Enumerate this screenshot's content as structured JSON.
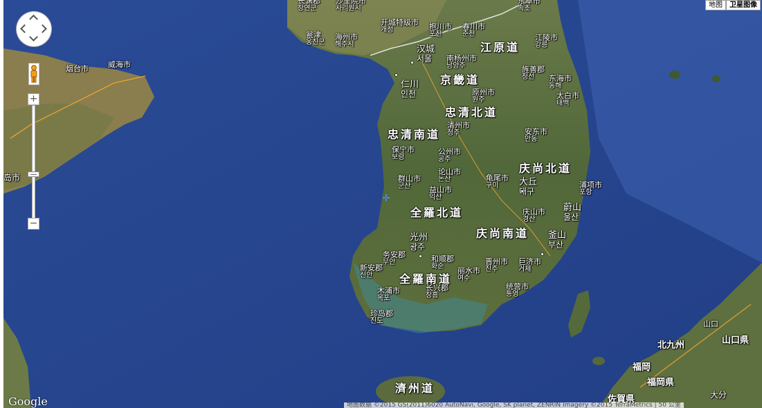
{
  "map_type": {
    "map_label": "地图",
    "satellite_label": "卫星图像",
    "active": "satellite"
  },
  "controls": {
    "zoom_in": "+",
    "zoom_out": "−"
  },
  "provinces": [
    {
      "name": "江原道"
    },
    {
      "name": "京畿道"
    },
    {
      "name": "忠清北道"
    },
    {
      "name": "忠清南道"
    },
    {
      "name": "庆尚北道"
    },
    {
      "name": "全羅北道"
    },
    {
      "name": "庆尚南道"
    },
    {
      "name": "全羅南道"
    },
    {
      "name": "濟州道"
    }
  ],
  "cities": [
    {
      "name": "长渊郡",
      "sub": "장연군"
    },
    {
      "name": "沙里院市",
      "sub": "사리원시"
    },
    {
      "name": "东草市",
      "sub": "속초"
    },
    {
      "name": "瓮津",
      "sub": "옹진군"
    },
    {
      "name": "海州市",
      "sub": "해주시"
    },
    {
      "name": "开城特级市",
      "sub": "개성"
    },
    {
      "name": "抱川市",
      "sub": "포천"
    },
    {
      "name": "春川市",
      "sub": "춘천"
    },
    {
      "name": "江陵市",
      "sub": "강릉"
    },
    {
      "name": "汉城",
      "sub": "서울"
    },
    {
      "name": "南杨州市",
      "sub": "남양주"
    },
    {
      "name": "旌善郡",
      "sub": "정선"
    },
    {
      "name": "东海市",
      "sub": "동해"
    },
    {
      "name": "仁川",
      "sub": "인천"
    },
    {
      "name": "原州市",
      "sub": "원주"
    },
    {
      "name": "太白市",
      "sub": "태백"
    },
    {
      "name": "清州市",
      "sub": "청주"
    },
    {
      "name": "安东市",
      "sub": "안동"
    },
    {
      "name": "保宁市",
      "sub": "보령"
    },
    {
      "name": "公州市",
      "sub": "공주"
    },
    {
      "name": "论山市",
      "sub": "논산"
    },
    {
      "name": "群山市",
      "sub": "군산"
    },
    {
      "name": "益山市",
      "sub": "익산"
    },
    {
      "name": "龟尾市",
      "sub": "구미"
    },
    {
      "name": "大丘",
      "sub": "대구"
    },
    {
      "name": "浦项市",
      "sub": "포항"
    },
    {
      "name": "庆山市",
      "sub": "경산"
    },
    {
      "name": "蔚山",
      "sub": "울산"
    },
    {
      "name": "光州",
      "sub": "광주"
    },
    {
      "name": "釜山",
      "sub": "부산"
    },
    {
      "name": "务安郡",
      "sub": "무안"
    },
    {
      "name": "和顺郡",
      "sub": "화순"
    },
    {
      "name": "晋州市",
      "sub": "진주"
    },
    {
      "name": "巨济市",
      "sub": "거제"
    },
    {
      "name": "新安郡",
      "sub": "신안"
    },
    {
      "name": "丽水市",
      "sub": "여수"
    },
    {
      "name": "木浦市",
      "sub": "목포"
    },
    {
      "name": "长兴郡",
      "sub": "장흥"
    },
    {
      "name": "统营市",
      "sub": "통영"
    },
    {
      "name": "珍岛郡",
      "sub": "진도"
    },
    {
      "name": "烟台市",
      "sub": ""
    },
    {
      "name": "威海市",
      "sub": ""
    },
    {
      "name": "青岛市",
      "sub": ""
    },
    {
      "name": "山口",
      "sub": ""
    },
    {
      "name": "北九州",
      "sub": ""
    },
    {
      "name": "山口県",
      "sub": ""
    },
    {
      "name": "福岡",
      "sub": ""
    },
    {
      "name": "福岡県",
      "sub": ""
    },
    {
      "name": "佐賀県",
      "sub": ""
    },
    {
      "name": "大分",
      "sub": ""
    }
  ],
  "logo": "Google",
  "copyright": "地图数据 ©2015 GS(2011)6020 AutoNavi, Google, SK planet, ZENRIN Imagery ©2015 TerraMetrics | 50 公里"
}
